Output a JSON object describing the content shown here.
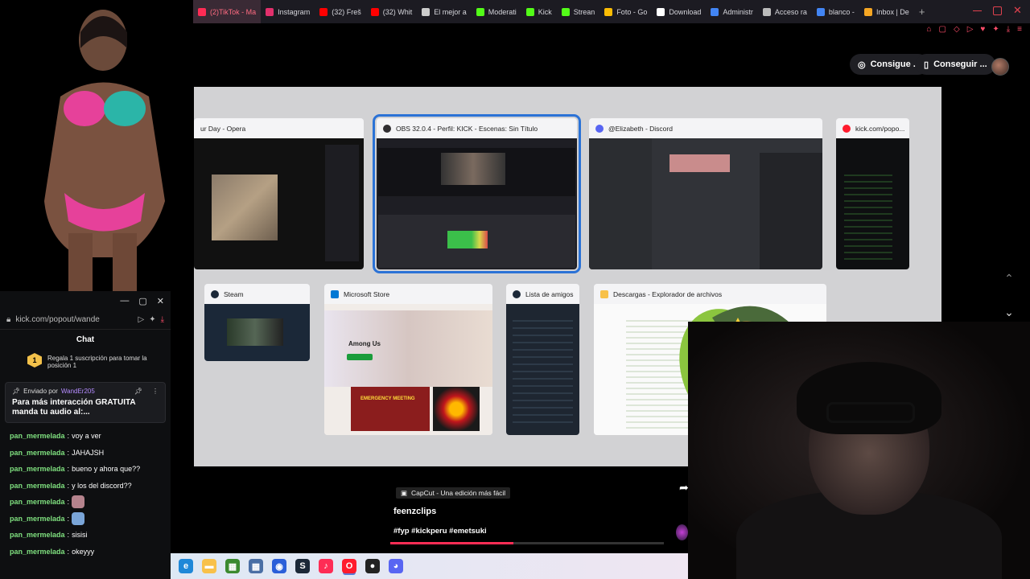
{
  "browser": {
    "tabs": [
      {
        "label": "(2)TikTok - Ma",
        "color": "#fe2c55",
        "active": true
      },
      {
        "label": "Instagram",
        "color": "#e1306c",
        "active": false
      },
      {
        "label": "(32) Freš",
        "color": "#ff0000",
        "active": false
      },
      {
        "label": "(32) Whit",
        "color": "#ff0000",
        "active": false
      },
      {
        "label": "El mejor a",
        "color": "#cccccc",
        "active": false
      },
      {
        "label": "Moderati",
        "color": "#53fc18",
        "active": false
      },
      {
        "label": "Kick",
        "color": "#53fc18",
        "active": false
      },
      {
        "label": "Strean",
        "color": "#53fc18",
        "active": false
      },
      {
        "label": "Foto - Go",
        "color": "#fbbc04",
        "active": false
      },
      {
        "label": "Download",
        "color": "#ffffff",
        "active": false
      },
      {
        "label": "Administr",
        "color": "#4285f4",
        "active": false
      },
      {
        "label": "Acceso ra",
        "color": "#bbbbbb",
        "active": false
      },
      {
        "label": "blanco - ",
        "color": "#4285f4",
        "active": false
      },
      {
        "label": "Inbox | De",
        "color": "#f5a623",
        "active": false
      }
    ],
    "new_tab": "+"
  },
  "page_top": {
    "pill_1": "Consigue ...",
    "pill_2": "Conseguir ..."
  },
  "switcher": {
    "windows_row1": [
      {
        "title": "ur Day - Opera",
        "color": "#ff1b2d"
      },
      {
        "title": "OBS 32.0.4 - Perfil: KICK - Escenas: Sin Título",
        "color": "#302e31"
      },
      {
        "title": "@Elizabeth - Discord",
        "color": "#5865f2"
      },
      {
        "title": "kick.com/popo...",
        "color": "#ff1b2d"
      }
    ],
    "windows_row2": [
      {
        "title": "Steam",
        "color": "#1b2838"
      },
      {
        "title": "Microsoft Store",
        "color": "#0078d4"
      },
      {
        "title": "Lista de amigos",
        "color": "#1b2838"
      },
      {
        "title": "Descargas - Explorador de archivos",
        "color": "#f8c14a"
      }
    ],
    "store_game": "Among Us",
    "store_banner": "EMERGENCY MEETING"
  },
  "chat": {
    "url": "kick.com/popout/wande",
    "title": "Chat",
    "sub_badge": "1",
    "sub_text": "Regala 1 suscripción para tomar la posición 1",
    "pinned_prefix": "Enviado por",
    "pinned_user": "WandEr205",
    "pinned_message": "Para más interacción GRATUITA manda tu audio al:...",
    "messages": [
      {
        "user": "pan_mermelada",
        "text": "voy a ver",
        "emote": ""
      },
      {
        "user": "pan_mermelada",
        "text": "JAHAJSH",
        "emote": ""
      },
      {
        "user": "pan_mermelada",
        "text": "bueno y ahora que??",
        "emote": ""
      },
      {
        "user": "pan_mermelada",
        "text": "y los del discord??",
        "emote": ""
      },
      {
        "user": "pan_mermelada",
        "text": "",
        "emote": "#b5838d"
      },
      {
        "user": "pan_mermelada",
        "text": "",
        "emote": "#7aa5d8"
      },
      {
        "user": "pan_mermelada",
        "text": "sisisi",
        "emote": ""
      },
      {
        "user": "pan_mermelada",
        "text": "okeyyy",
        "emote": ""
      }
    ]
  },
  "video": {
    "capcut_label": "CapCut - Una edición más fácil",
    "username": "feenzclips",
    "hashtags": "#fyp #kickperu #emetsuki",
    "progress": 0.45
  },
  "taskbar": {
    "apps": [
      {
        "name": "edge",
        "color": "#1e88d8",
        "glyph": "e"
      },
      {
        "name": "explorer",
        "color": "#f8c14a",
        "glyph": "▬"
      },
      {
        "name": "minecraft",
        "color": "#3b8a2f",
        "glyph": "▦"
      },
      {
        "name": "calculator",
        "color": "#4a6fa5",
        "glyph": "▦"
      },
      {
        "name": "obs",
        "color": "#2b5fd9",
        "glyph": "◉"
      },
      {
        "name": "steam",
        "color": "#1b2838",
        "glyph": "S"
      },
      {
        "name": "tiktok",
        "color": "#fe2c55",
        "glyph": "♪"
      },
      {
        "name": "opera",
        "color": "#ff1b2d",
        "glyph": "O"
      },
      {
        "name": "obs-studio",
        "color": "#222222",
        "glyph": "●"
      },
      {
        "name": "discord",
        "color": "#5865f2",
        "glyph": "◕"
      }
    ]
  }
}
